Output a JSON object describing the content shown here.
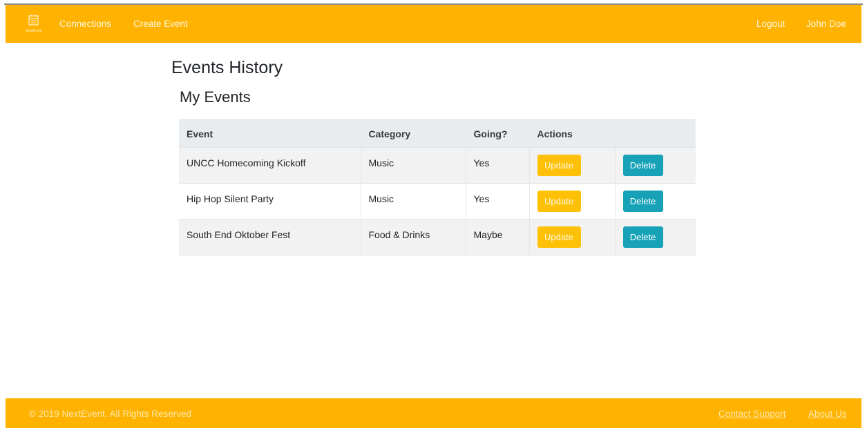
{
  "navbar": {
    "logo_icon": "calendar-logo-icon",
    "logo_text": "NextEvent",
    "links": {
      "connections": "Connections",
      "create_event": "Create Event"
    },
    "right_links": {
      "logout": "Logout",
      "user": "John Doe"
    },
    "background": "#ffb300"
  },
  "main": {
    "page_title": "Events History",
    "section_title": "My Events"
  },
  "table": {
    "headers": {
      "event": "Event",
      "category": "Category",
      "going": "Going?",
      "actions": "Actions"
    },
    "rows": [
      {
        "event": "UNCC Homecoming Kickoff",
        "category": "Music",
        "going": "Yes",
        "update": "Update",
        "delete": "Delete"
      },
      {
        "event": "Hip Hop Silent Party",
        "category": "Music",
        "going": "Yes",
        "update": "Update",
        "delete": "Delete"
      },
      {
        "event": "South End Oktober Fest",
        "category": "Food & Drinks",
        "going": "Maybe",
        "update": "Update",
        "delete": "Delete"
      }
    ],
    "colors": {
      "update": "#ffc107",
      "delete": "#17a2b8",
      "header_bg": "#e9ecef",
      "stripe_bg": "#f2f2f2"
    }
  },
  "footer": {
    "copyright": "© 2019 NextEvent. All Rights Reserved",
    "links": {
      "contact": "Contact Support",
      "about": "About Us"
    }
  }
}
